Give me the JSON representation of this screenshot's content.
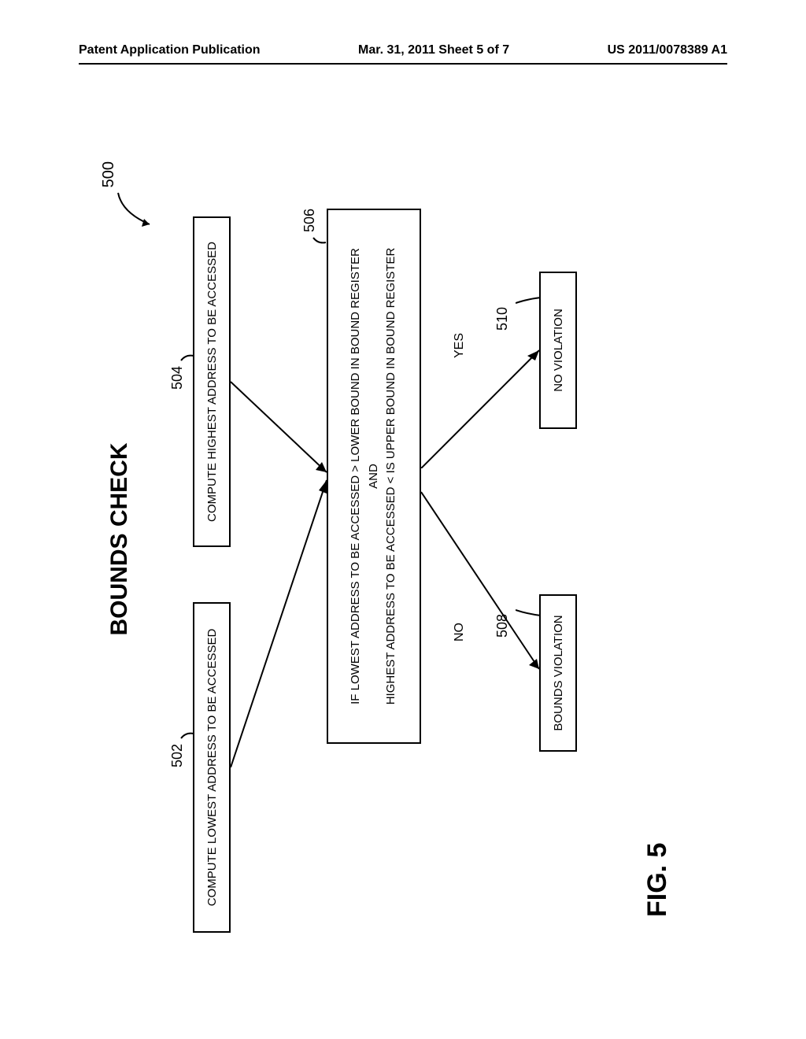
{
  "header": {
    "left": "Patent Application Publication",
    "center": "Mar. 31, 2011 Sheet 5 of 7",
    "right": "US 2011/0078389 A1"
  },
  "diagram": {
    "title": "BOUNDS CHECK",
    "ref_500": "500",
    "ref_502": "502",
    "ref_504": "504",
    "ref_506": "506",
    "ref_508": "508",
    "ref_510": "510",
    "box_502": "COMPUTE LOWEST ADDRESS TO BE ACCESSED",
    "box_504": "COMPUTE HIGHEST ADDRESS TO BE ACCESSED",
    "box_506_line1": "IF LOWEST ADDRESS TO BE ACCESSED > LOWER BOUND IN BOUND REGISTER",
    "box_506_line2": "AND",
    "box_506_line3": "HIGHEST ADDRESS TO BE ACCESSED < IS UPPER BOUND IN BOUND REGISTER",
    "box_508": "BOUNDS VIOLATION",
    "box_510": "NO VIOLATION",
    "label_no": "NO",
    "label_yes": "YES",
    "fig_label": "FIG. 5"
  }
}
